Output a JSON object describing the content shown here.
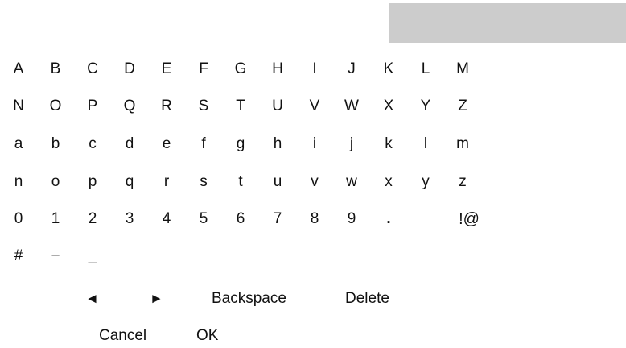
{
  "input": {
    "value": ""
  },
  "keyboard": {
    "rows": [
      [
        "A",
        "B",
        "C",
        "D",
        "E",
        "F",
        "G",
        "H",
        "I",
        "J",
        "K",
        "L",
        "M"
      ],
      [
        "N",
        "O",
        "P",
        "Q",
        "R",
        "S",
        "T",
        "U",
        "V",
        "W",
        "X",
        "Y",
        "Z"
      ],
      [
        "a",
        "b",
        "c",
        "d",
        "e",
        "f",
        "g",
        "h",
        "i",
        "j",
        "k",
        "l",
        "m"
      ],
      [
        "n",
        "o",
        "p",
        "q",
        "r",
        "s",
        "t",
        "u",
        "v",
        "w",
        "x",
        "y",
        "z"
      ],
      [
        "0",
        "1",
        "2",
        "3",
        "4",
        "5",
        "6",
        "7",
        "8",
        "9",
        ".",
        "",
        ""
      ],
      [
        "#",
        "−",
        "_"
      ]
    ],
    "special_key": "!@"
  },
  "controls": {
    "left_arrow": "◄",
    "right_arrow": "►",
    "backspace": "Backspace",
    "delete": "Delete",
    "cancel": "Cancel",
    "ok": "OK"
  }
}
